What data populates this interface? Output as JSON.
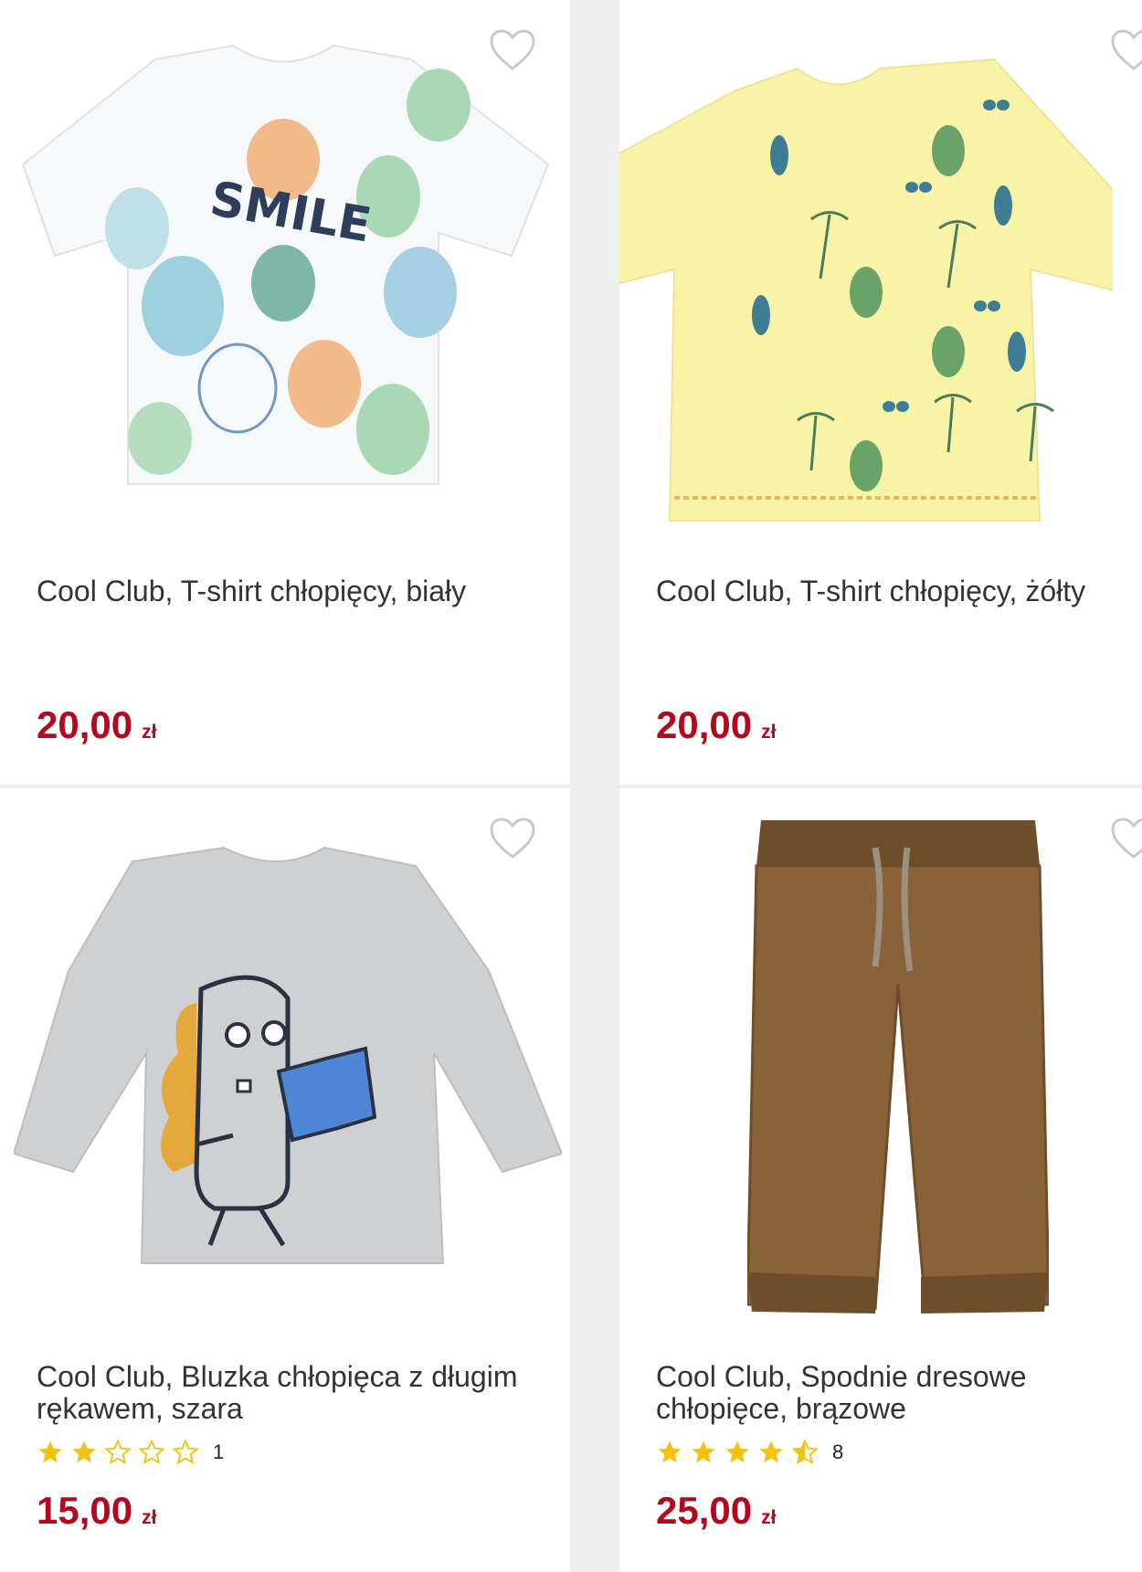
{
  "colors": {
    "price": "#b3071d",
    "star": "#f4c20d",
    "heart": "#c9c9c9",
    "title": "#333333"
  },
  "products": [
    {
      "title": "Cool Club, T-shirt chłopięcy, biały",
      "price": "20,00",
      "currency": "zł",
      "image_icon": "white-pineapple-tshirt-image",
      "favorite_icon": "heart-icon"
    },
    {
      "title": "Cool Club, T-shirt chłopięcy, żółty",
      "price": "20,00",
      "currency": "zł",
      "image_icon": "yellow-palm-tshirt-image",
      "favorite_icon": "heart-icon"
    },
    {
      "title": "Cool Club, Bluzka chłopięca z długim rękawem, szara",
      "price": "15,00",
      "currency": "zł",
      "rating": 2,
      "rating_max": 5,
      "reviews": "1",
      "image_icon": "grey-dino-longsleeve-image",
      "favorite_icon": "heart-icon"
    },
    {
      "title": "Cool Club, Spodnie dresowe chłopięce, brązowe",
      "price": "25,00",
      "currency": "zł",
      "rating": 4.5,
      "rating_max": 5,
      "reviews": "8",
      "image_icon": "brown-sweatpants-image",
      "favorite_icon": "heart-icon"
    }
  ]
}
